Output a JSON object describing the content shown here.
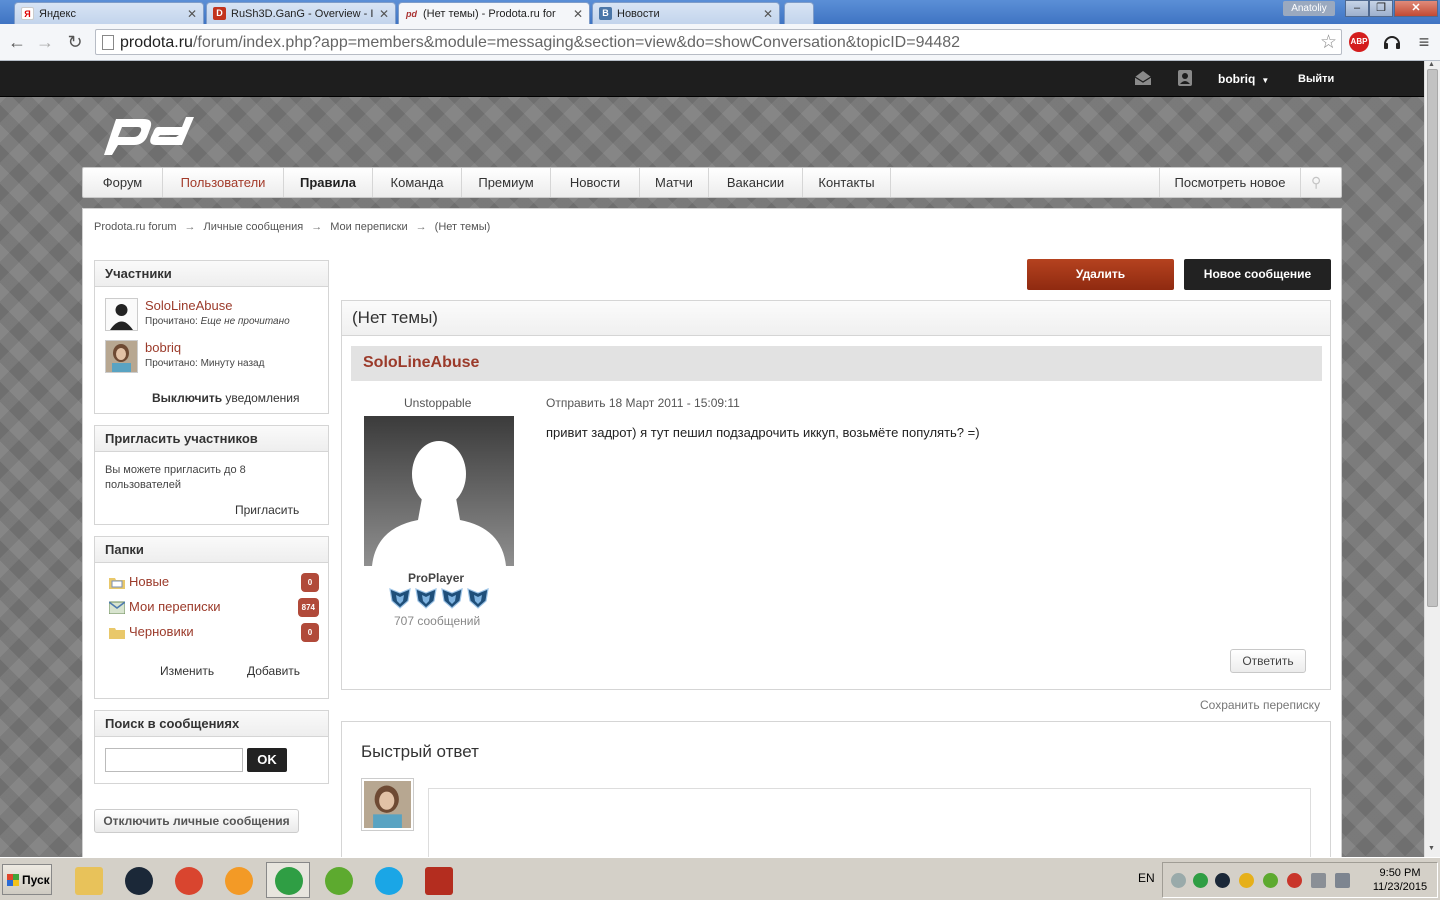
{
  "browser": {
    "tabs": [
      {
        "label": "Яндекс",
        "favicon": "Я",
        "color": "#ffffff",
        "fcolor": "#d00"
      },
      {
        "label": "RuSh3D.GanG - Overview - I",
        "favicon": "D",
        "color": "#c2331d",
        "fcolor": "#fff"
      },
      {
        "label": "(Нет темы) - Prodota.ru for",
        "favicon": "pd",
        "color": "#f4f6f9",
        "fcolor": "#a33"
      },
      {
        "label": "Новости",
        "favicon": "B",
        "color": "#4a76a8",
        "fcolor": "#fff"
      }
    ],
    "window_user": "Anatoliy",
    "window_buttons": {
      "minimize": "–",
      "restore": "❐",
      "close": "✕"
    },
    "url_host": "prodota.ru",
    "url_path": "/forum/index.php?app=members&module=messaging&section=view&do=showConversation&topicID=94482",
    "icons": {
      "back": "←",
      "forward": "→",
      "reload": "↻",
      "star": "☆",
      "abp": "ABP",
      "menu": "≡",
      "headset": "🎧"
    }
  },
  "site": {
    "topbar": {
      "username": "bobriq",
      "caret": "▼",
      "logout": "Выйти",
      "mail_icon": "✉",
      "user_icon": "👤"
    },
    "nav": [
      {
        "label": "Форум",
        "style": ""
      },
      {
        "label": "Пользователи",
        "style": "hl"
      },
      {
        "label": "Правила",
        "style": "bold"
      },
      {
        "label": "Команда",
        "style": ""
      },
      {
        "label": "Премиум",
        "style": ""
      },
      {
        "label": "Новости",
        "style": ""
      },
      {
        "label": "Матчи",
        "style": ""
      },
      {
        "label": "Вакансии",
        "style": ""
      },
      {
        "label": "Контакты",
        "style": ""
      }
    ],
    "see_new": "Посмотреть новое",
    "pin_icon": "⚲",
    "breadcrumb": [
      "Prodota.ru forum",
      "Личные сообщения",
      "Мои переписки",
      "(Нет темы)"
    ],
    "breadcrumb_sep": "→",
    "participants": {
      "title": "Участники",
      "members": [
        {
          "name": "SoloLineAbuse",
          "read_label": "Прочитано:",
          "read_value": "Еще не прочитано",
          "italic": true
        },
        {
          "name": "bobriq",
          "read_label": "Прочитано:",
          "read_value": "Минуту назад",
          "italic": false
        }
      ],
      "notif_bold": "Выключить",
      "notif_rest": " уведомления"
    },
    "invite": {
      "title": "Пригласить участников",
      "text": "Вы можете пригласить до 8 пользователей",
      "link": "Пригласить"
    },
    "folders": {
      "title": "Папки",
      "items": [
        {
          "name": "Новые",
          "count": "0"
        },
        {
          "name": "Мои переписки",
          "count": "874"
        },
        {
          "name": "Черновики",
          "count": "0"
        }
      ],
      "edit": "Изменить",
      "add": "Добавить"
    },
    "search": {
      "title": "Поиск в сообщениях",
      "button": "OK",
      "value": ""
    },
    "disable_pm": "Отключить личные сообщения",
    "actions": {
      "delete": "Удалить",
      "new_message": "Новое сообщение"
    },
    "conversation": {
      "title": "(Нет темы)",
      "poster": "SoloLineAbuse",
      "poster_title": "Unstoppable",
      "rank": "ProPlayer",
      "rank_pips": 4,
      "post_count": "707 сообщений",
      "date": "Отправить 18 Март 2011 - 15:09:11",
      "body": "привит задрот) я тут пешил подзадрочить иккуп, возьмёте популять? =)",
      "reply": "Ответить"
    },
    "save_conversation": "Сохранить переписку",
    "quick_reply": {
      "title": "Быстрый ответ"
    }
  },
  "taskbar": {
    "start": "Пуск",
    "apps": [
      {
        "name": "explorer",
        "color": "#e8c25a"
      },
      {
        "name": "steam",
        "color": "#1b2838"
      },
      {
        "name": "ccleaner",
        "color": "#d9452f"
      },
      {
        "name": "firefox",
        "color": "#f39a26"
      },
      {
        "name": "chrome",
        "color": "#2f9e44"
      },
      {
        "name": "utorrent",
        "color": "#5daa2f"
      },
      {
        "name": "skype",
        "color": "#1aa6e6"
      },
      {
        "name": "dota2",
        "color": "#b42d1f"
      }
    ],
    "lang": "EN",
    "time": "9:50 PM",
    "date": "11/23/2015"
  }
}
